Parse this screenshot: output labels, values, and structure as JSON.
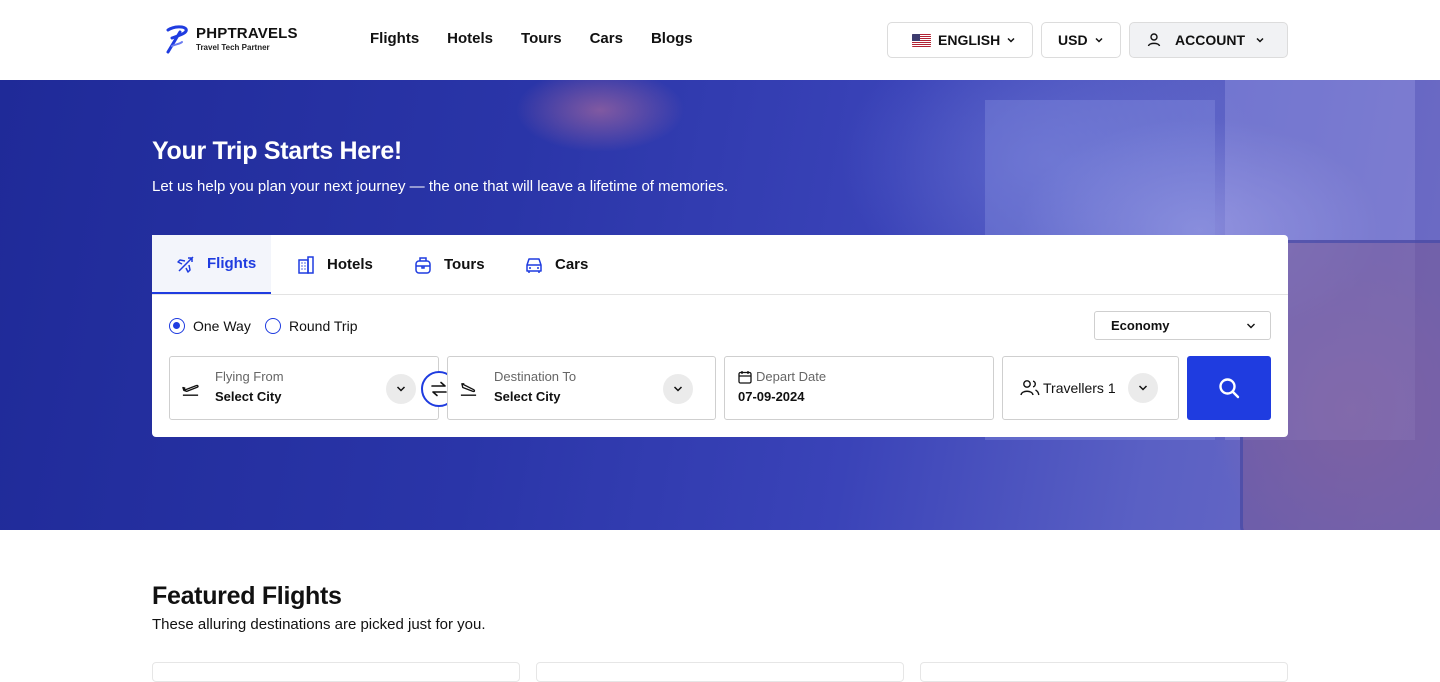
{
  "brand": {
    "name": "PHPTRAVELS",
    "tagline": "Travel Tech Partner"
  },
  "nav": {
    "items": [
      "Flights",
      "Hotels",
      "Tours",
      "Cars",
      "Blogs"
    ]
  },
  "header": {
    "language": "ENGLISH",
    "currency": "USD",
    "account": "ACCOUNT"
  },
  "hero": {
    "title": "Your Trip Starts Here!",
    "subtitle": "Let us help you plan your next journey — the one that will leave a lifetime of memories."
  },
  "search": {
    "tabs": [
      "Flights",
      "Hotels",
      "Tours",
      "Cars"
    ],
    "active_tab": "Flights",
    "trip_types": [
      "One Way",
      "Round Trip"
    ],
    "selected_trip_type": "One Way",
    "cabin_class": "Economy",
    "from": {
      "label": "Flying From",
      "value": "Select City"
    },
    "to": {
      "label": "Destination To",
      "value": "Select City"
    },
    "date": {
      "label": "Depart Date",
      "value": "07-09-2024"
    },
    "travellers": "Travellers 1"
  },
  "featured": {
    "title": "Featured Flights",
    "subtitle": "These alluring destinations are picked just for you."
  },
  "colors": {
    "accent": "#1f3ce0",
    "hero": "#2a35a8"
  },
  "icons": [
    "logo-icon",
    "us-flag-icon",
    "chevron-down-icon",
    "user-icon",
    "plane-icon",
    "building-icon",
    "bag-icon",
    "car-icon",
    "takeoff-icon",
    "landing-icon",
    "swap-icon",
    "calendar-icon",
    "users-icon",
    "search-icon"
  ]
}
